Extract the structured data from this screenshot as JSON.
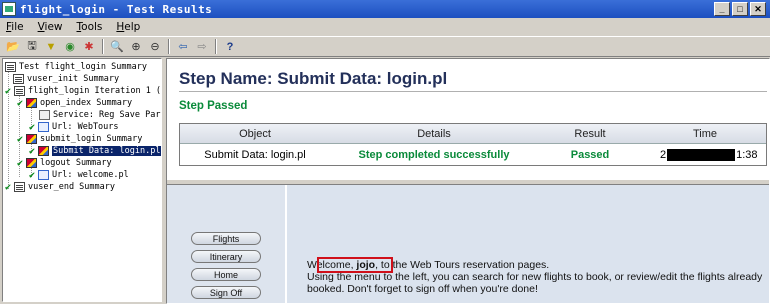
{
  "window": {
    "title": "flight_login - Test Results"
  },
  "menu": [
    {
      "label": "File",
      "mnemonic": "F"
    },
    {
      "label": "View",
      "mnemonic": "V"
    },
    {
      "label": "Tools",
      "mnemonic": "T"
    },
    {
      "label": "Help",
      "mnemonic": "H"
    }
  ],
  "toolbar_icons": [
    "open-icon",
    "save-icon",
    "filter-icon",
    "search-icon",
    "refresh-icon",
    "find-icon",
    "zoom-in-icon",
    "zoom-out-icon",
    "back-arrow-icon",
    "forward-arrow-icon",
    "help-icon"
  ],
  "tree": [
    {
      "label": "Test flight_login Summary"
    },
    {
      "label": "vuser_init Summary"
    },
    {
      "label": "flight_login Iteration 1 (Ro"
    },
    {
      "label": "open_index Summary"
    },
    {
      "label": "Service: Reg Save Pare"
    },
    {
      "label": "Url: WebTours"
    },
    {
      "label": "submit_login Summary"
    },
    {
      "label": "Submit Data: login.pl"
    },
    {
      "label": "logout Summary"
    },
    {
      "label": "Url: welcome.pl"
    },
    {
      "label": "vuser_end Summary"
    }
  ],
  "step": {
    "title": "Step Name: Submit Data: login.pl",
    "status": "Step Passed",
    "columns": [
      "Object",
      "Details",
      "Result",
      "Time"
    ],
    "row": {
      "object": "Submit Data: login.pl",
      "details": "Step completed successfully",
      "result": "Passed",
      "time_prefix": "2",
      "time_suffix": "1:38"
    }
  },
  "webtours": {
    "nav": [
      "Flights",
      "Itinerary",
      "Home",
      "Sign Off"
    ],
    "welcome_prefix": "Welcome, ",
    "user": "jojo",
    "welcome_suffix": ", to the Web Tours reservation pages.",
    "body": "Using the menu to the left, you can search for new flights to book, or review/edit the flights already booked. Don't forget to sign off when you're done!"
  }
}
